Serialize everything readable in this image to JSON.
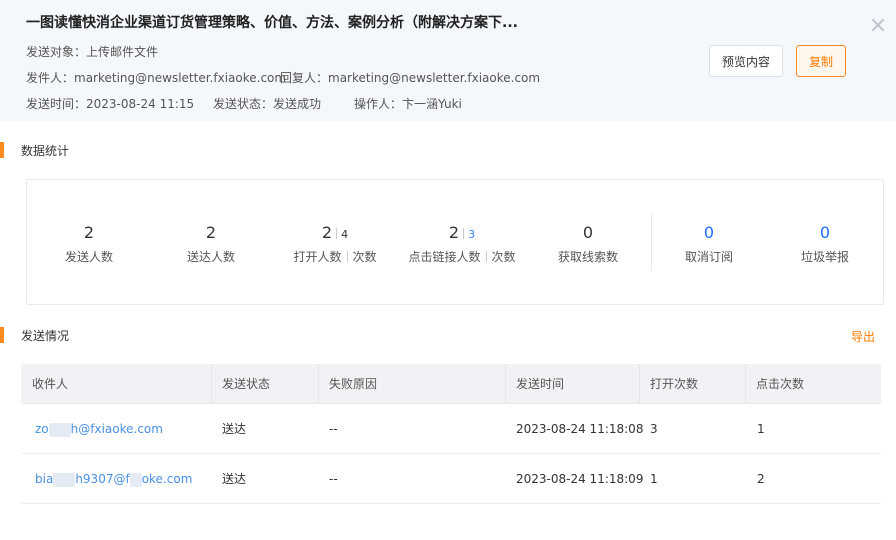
{
  "header": {
    "title": "一图读懂快消企业渠道订货管理策略、价值、方法、案例分析（附解决方案下...",
    "send_target_label": "发送对象：",
    "send_target_value": "上传邮件文件",
    "sender_label": "发件人：",
    "sender_value": "marketing@newsletter.fxiaoke.com",
    "reply_label": "回复人：",
    "reply_value": "marketing@newsletter.fxiaoke.com",
    "send_time_label": "发送时间：",
    "send_time_value": "2023-08-24 11:15",
    "status_label": "发送状态：",
    "status_value": "发送成功",
    "operator_label": "操作人：",
    "operator_value": "卞一涵Yuki",
    "preview_button": "预览内容",
    "copy_button": "复制"
  },
  "stats": {
    "section_title": "数据统计",
    "items": [
      {
        "value": "2",
        "label": "发送人数"
      },
      {
        "value": "2",
        "label": "送达人数"
      },
      {
        "value": "2",
        "sub": "4",
        "label": "打开人数",
        "sub_label": "次数"
      },
      {
        "value": "2",
        "sub": "3",
        "label": "点击链接人数",
        "sub_label": "次数"
      },
      {
        "value": "0",
        "label": "获取线索数"
      },
      {
        "value": "0",
        "label": "取消订阅"
      },
      {
        "value": "0",
        "label": "垃圾举报"
      }
    ]
  },
  "sending": {
    "section_title": "发送情况",
    "export_label": "导出",
    "columns": [
      "收件人",
      "发送状态",
      "失败原因",
      "发送时间",
      "打开次数",
      "点击次数"
    ],
    "rows": [
      {
        "recipient_a": "zo",
        "recipient_b": "h@fxiaoke.com",
        "status": "送达",
        "reason": "--",
        "time": "2023-08-24 11:18:08",
        "opens": "3",
        "clicks": "1"
      },
      {
        "recipient_a": "bia",
        "recipient_b": "h9307@f",
        "recipient_c": "oke.com",
        "status": "送达",
        "reason": "--",
        "time": "2023-08-24 11:18:09",
        "opens": "1",
        "clicks": "2"
      }
    ]
  }
}
